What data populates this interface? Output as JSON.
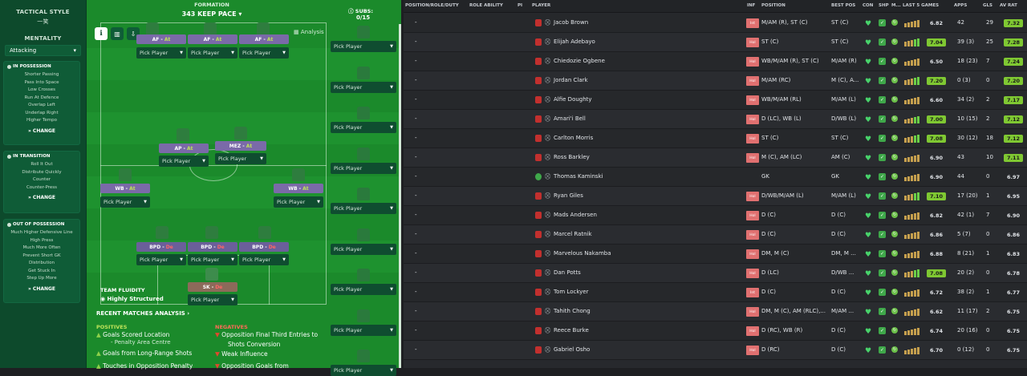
{
  "left": {
    "tactical_style": "TACTICAL STYLE",
    "style_name": "一笑",
    "mentality_label": "MENTALITY",
    "mentality_value": "Attacking",
    "in_possession": {
      "title": "IN POSSESSION",
      "items": [
        "Shorter Passing",
        "Pass Into Space",
        "Low Crosses",
        "Run At Defence",
        "Overlap Left",
        "Underlap Right",
        "Higher Tempo"
      ],
      "change": "CHANGE"
    },
    "in_transition": {
      "title": "IN TRANSITION",
      "items": [
        "Roll It Out",
        "Distribute Quickly",
        "Counter",
        "Counter-Press"
      ],
      "change": "CHANGE"
    },
    "out_of_possession": {
      "title": "OUT OF POSSESSION",
      "items": [
        "Much Higher Defensive Line",
        "High Press",
        "Much More Often",
        "Prevent Short GK",
        "Distribution",
        "Get Stuck In",
        "Step Up More"
      ],
      "change": "CHANGE"
    }
  },
  "pitch": {
    "formation_label": "FORMATION",
    "formation_value": "343 KEEP PACE",
    "analysis": "Analysis",
    "subs_label": "SUBS:",
    "subs_value": "0/15",
    "pick_player": "Pick Player",
    "roles": {
      "af1": {
        "role": "AF",
        "duty": "At"
      },
      "af2": {
        "role": "AF",
        "duty": "At"
      },
      "af3": {
        "role": "AF",
        "duty": "At"
      },
      "ap": {
        "role": "AP",
        "duty": "At"
      },
      "mez": {
        "role": "MEZ",
        "duty": "At"
      },
      "wbl": {
        "role": "WB",
        "duty": "At"
      },
      "wbr": {
        "role": "WB",
        "duty": "At"
      },
      "bpd1": {
        "role": "BPD",
        "duty": "De"
      },
      "bpd2": {
        "role": "BPD",
        "duty": "De"
      },
      "bpd3": {
        "role": "BPD",
        "duty": "De"
      },
      "sk": {
        "role": "SK",
        "duty": "De"
      }
    },
    "fluidity_label": "TEAM FLUIDITY",
    "fluidity_value": "Highly Structured",
    "recent_analysis": "RECENT MATCHES ANALYSIS",
    "positives_label": "POSITIVES",
    "negatives_label": "NEGATIVES",
    "positives": [
      "Goals Scored Location",
      "- Penalty Area Centre",
      "Goals from Long-Range Shots",
      "Touches in Opposition Penalty"
    ],
    "negatives": [
      "Opposition Final Third Entries to",
      "Shots Conversion",
      "Weak Influence",
      "Opposition Goals from"
    ]
  },
  "table": {
    "headers": [
      "POSITION/ROLE/DUTY",
      "ROLE ABILITY",
      "PI",
      "PLAYER",
      "INF",
      "POSITION",
      "BEST POS",
      "CON",
      "SHP",
      "M...",
      "LAST 5 GAMES",
      "APPS",
      "GLS",
      "AV RAT"
    ],
    "rows": [
      {
        "player": "Jacob Brown",
        "inf": "Int",
        "pos": "M/AM (R), ST (C)",
        "best": "ST (C)",
        "rating": "6.82",
        "apps": "42",
        "gls": "29",
        "av": "7.32",
        "hl": "#f1f1f1"
      },
      {
        "player": "Elijah Adebayo",
        "inf": "Hol",
        "pos": "ST (C)",
        "best": "ST (C)",
        "rating": "7.04",
        "apps": "39 (3)",
        "gls": "25",
        "av": "7.28",
        "hl": "#8ed14a"
      },
      {
        "player": "Chiedozie Ogbene",
        "inf": "Hol",
        "pos": "WB/M/AM (R), ST (C)",
        "best": "M/AM (R)",
        "rating": "6.50",
        "apps": "18 (23)",
        "gls": "7",
        "av": "7.24",
        "hl": "#f1f1f1"
      },
      {
        "player": "Jordan Clark",
        "inf": "Hol",
        "pos": "M/AM (RC)",
        "best": "M (C), A...",
        "rating": "7.20",
        "apps": "0 (3)",
        "gls": "0",
        "av": "7.20",
        "hl": "#8ed14a"
      },
      {
        "player": "Alfie Doughty",
        "inf": "Hol",
        "pos": "WB/M/AM (RL)",
        "best": "M/AM (L)",
        "rating": "6.60",
        "apps": "34 (2)",
        "gls": "2",
        "av": "7.17",
        "hl": "#f1f1f1"
      },
      {
        "player": "Amari'i Bell",
        "inf": "Hol",
        "pos": "D (LC), WB (L)",
        "best": "D/WB (L)",
        "rating": "7.00",
        "apps": "10 (15)",
        "gls": "2",
        "av": "7.12",
        "hl": "#8ed14a"
      },
      {
        "player": "Carlton Morris",
        "inf": "Hol",
        "pos": "ST (C)",
        "best": "ST (C)",
        "rating": "7.08",
        "apps": "30 (12)",
        "gls": "18",
        "av": "7.12",
        "hl": "#8ed14a"
      },
      {
        "player": "Ross Barkley",
        "inf": "Hol",
        "pos": "M (C), AM (LC)",
        "best": "AM (C)",
        "rating": "6.90",
        "apps": "43",
        "gls": "10",
        "av": "7.11",
        "hl": "#f1f1f1"
      },
      {
        "player": "Thomas Kaminski",
        "inf": "",
        "pos": "GK",
        "best": "GK",
        "rating": "6.90",
        "apps": "44",
        "gls": "0",
        "av": "6.97",
        "hl": "#f1f1f1"
      },
      {
        "player": "Ryan Giles",
        "inf": "Hol",
        "pos": "D/WB/M/AM (L)",
        "best": "M/AM (L)",
        "rating": "7.10",
        "apps": "17 (20)",
        "gls": "1",
        "av": "6.95",
        "hl": "#8ed14a"
      },
      {
        "player": "Mads Andersen",
        "inf": "Hol",
        "pos": "D (C)",
        "best": "D (C)",
        "rating": "6.82",
        "apps": "42 (1)",
        "gls": "7",
        "av": "6.90",
        "hl": "#f1f1f1"
      },
      {
        "player": "Marcel Ratnik",
        "inf": "Hol",
        "pos": "D (C)",
        "best": "D (C)",
        "rating": "6.86",
        "apps": "5 (7)",
        "gls": "0",
        "av": "6.86",
        "hl": "#f1f1f1"
      },
      {
        "player": "Marvelous Nakamba",
        "inf": "Hol",
        "pos": "DM, M (C)",
        "best": "DM, M ...",
        "rating": "6.88",
        "apps": "8 (21)",
        "gls": "1",
        "av": "6.83",
        "hl": "#f1f1f1"
      },
      {
        "player": "Dan Potts",
        "inf": "Hol",
        "pos": "D (LC)",
        "best": "D/WB ...",
        "rating": "7.08",
        "apps": "20 (2)",
        "gls": "0",
        "av": "6.78",
        "hl": "#8ed14a"
      },
      {
        "player": "Tom Lockyer",
        "inf": "Int",
        "pos": "D (C)",
        "best": "D (C)",
        "rating": "6.72",
        "apps": "38 (2)",
        "gls": "1",
        "av": "6.77",
        "hl": "#f1f1f1"
      },
      {
        "player": "Tahith Chong",
        "inf": "Hol",
        "pos": "DM, M (C), AM (RLC),...",
        "best": "M/AM ...",
        "rating": "6.62",
        "apps": "11 (17)",
        "gls": "2",
        "av": "6.75",
        "hl": "#f1f1f1"
      },
      {
        "player": "Reece Burke",
        "inf": "Hol",
        "pos": "D (RC), WB (R)",
        "best": "D (C)",
        "rating": "6.74",
        "apps": "20 (16)",
        "gls": "0",
        "av": "6.75",
        "hl": "#f1f1f1"
      },
      {
        "player": "Gabriel Osho",
        "inf": "Hol",
        "pos": "D (RC)",
        "best": "D (C)",
        "rating": "6.70",
        "apps": "0 (12)",
        "gls": "0",
        "av": "6.75",
        "hl": "#f1f1f1"
      }
    ]
  }
}
